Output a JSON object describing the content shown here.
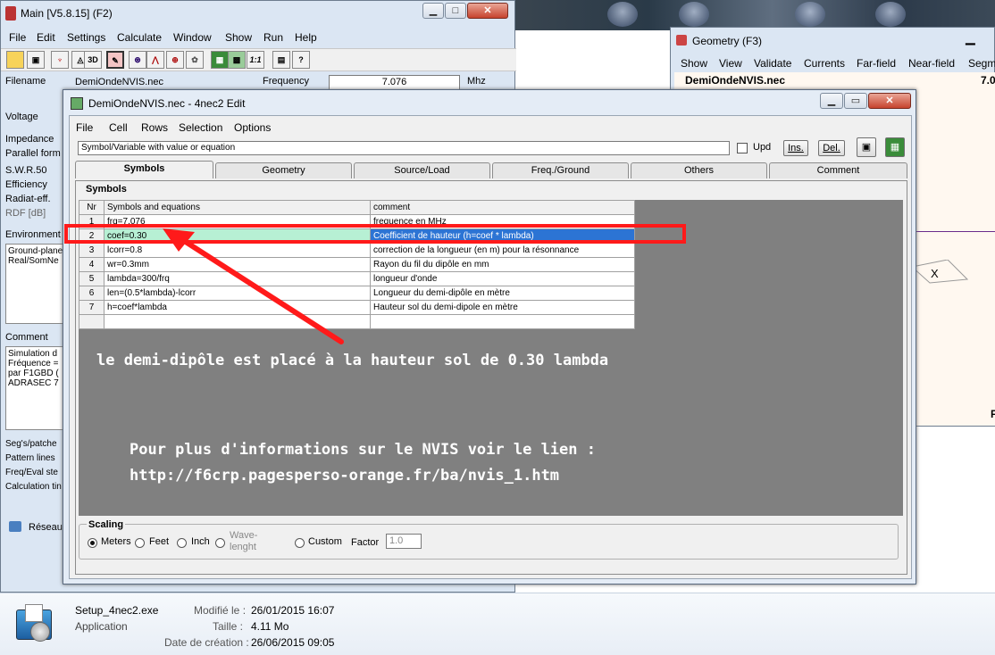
{
  "main_window": {
    "title": "Main [V5.8.15]  (F2)",
    "menu": [
      "File",
      "Edit",
      "Settings",
      "Calculate",
      "Window",
      "Show",
      "Run",
      "Help"
    ],
    "toolbar_icons": [
      "open-icon",
      "copy-icon",
      "antenna-icon",
      "3d-icon",
      "edit-icon",
      "pattern-icon",
      "sweep-icon",
      "smith-icon",
      "optimize-icon",
      "calculator-icon",
      "grid-icon",
      "scale-icon",
      "book-icon",
      "help-icon"
    ],
    "toolbar_3d": "3D",
    "toolbar_11": "1:1",
    "filename_label": "Filename",
    "filename_value": "DemiOndeNVIS.nec",
    "frequency_label": "Frequency",
    "frequency_value": "7.076",
    "frequency_unit": "Mhz",
    "labels": [
      "Voltage",
      "Impedance",
      "Parallel form",
      "S.W.R.50",
      "Efficiency",
      "Radiat-eff.",
      "RDF [dB]"
    ],
    "environment_label": "Environment",
    "environment_lines": [
      "Ground-plane",
      "Real/SomNe"
    ],
    "comment_label": "Comment",
    "comment_lines": [
      "Simulation d",
      "Fréquence =",
      "par F1GBD (",
      "ADRASEC 7"
    ],
    "bottom_labels": [
      "Seg's/patche",
      "Pattern lines",
      "Freq/Eval ste",
      "Calculation tin"
    ]
  },
  "geometry_window": {
    "title": "Geometry   (F3)",
    "menu": [
      "Show",
      "View",
      "Validate",
      "Currents",
      "Far-field",
      "Near-field",
      "Segm"
    ],
    "filename": "DemiOndeNVIS.nec",
    "value_partial": "7.0",
    "corner_letter": "F",
    "marker": "X"
  },
  "edit_window": {
    "title": "DemiOndeNVIS.nec - 4nec2 Edit",
    "menu": [
      "File",
      "Cell",
      "Rows",
      "Selection",
      "Options"
    ],
    "hint_field": "Symbol/Variable with value or equation",
    "upd_label": "Upd",
    "ins_label": "Ins.",
    "del_label": "Del.",
    "tabs": [
      "Symbols",
      "Geometry",
      "Source/Load",
      "Freq./Ground",
      "Others",
      "Comment"
    ],
    "section_title": "Symbols",
    "table": {
      "headers": [
        "Nr",
        "Symbols and equations",
        "comment"
      ],
      "rows": [
        {
          "nr": "1",
          "symbol": "frq=7.076",
          "comment": "frequence en MHz"
        },
        {
          "nr": "2",
          "symbol": "coef=0.30",
          "comment": "Coefficient de hauteur (h=coef * lambda)"
        },
        {
          "nr": "3",
          "symbol": "lcorr=0.8",
          "comment": "correction de la longueur (en m) pour la résonnance"
        },
        {
          "nr": "4",
          "symbol": "wr=0.3mm",
          "comment": "Rayon du fil du dipôle en mm"
        },
        {
          "nr": "5",
          "symbol": "lambda=300/frq",
          "comment": "longueur d'onde"
        },
        {
          "nr": "6",
          "symbol": "len=(0.5*lambda)-lcorr",
          "comment": "Longueur du demi-dipôle en mètre"
        },
        {
          "nr": "7",
          "symbol": "h=coef*lambda",
          "comment": "Hauteur sol du demi-dipole en mètre"
        }
      ]
    },
    "annotation_1": "le demi-dipôle est placé à la hauteur sol de 0.30 lambda",
    "annotation_2": "Pour plus d'informations sur le NVIS voir le lien :",
    "annotation_3": "http://f6crp.pagesperso-orange.fr/ba/nvis_1.htm",
    "scaling": {
      "title": "Scaling",
      "meters": "Meters",
      "feet": "Feet",
      "inch": "Inch",
      "wave_line1": "Wave-",
      "wave_line2": "lenght",
      "custom": "Custom",
      "factor_label": "Factor",
      "factor_value": "1.0"
    }
  },
  "explorer": {
    "network_label": "Réseau",
    "file_name": "Setup_4nec2.exe",
    "file_type": "Application",
    "modified_label": "Modifié le :",
    "modified_value": "26/01/2015 16:07",
    "size_label": "Taille :",
    "size_value": "4.11 Mo",
    "created_label": "Date de création :",
    "created_value": "26/06/2015 09:05"
  },
  "colors": {
    "highlight_red": "#ff1a1a",
    "selection_blue": "#2c74d4",
    "selection_green": "#b7f0d4",
    "panel_gray": "#808080"
  }
}
